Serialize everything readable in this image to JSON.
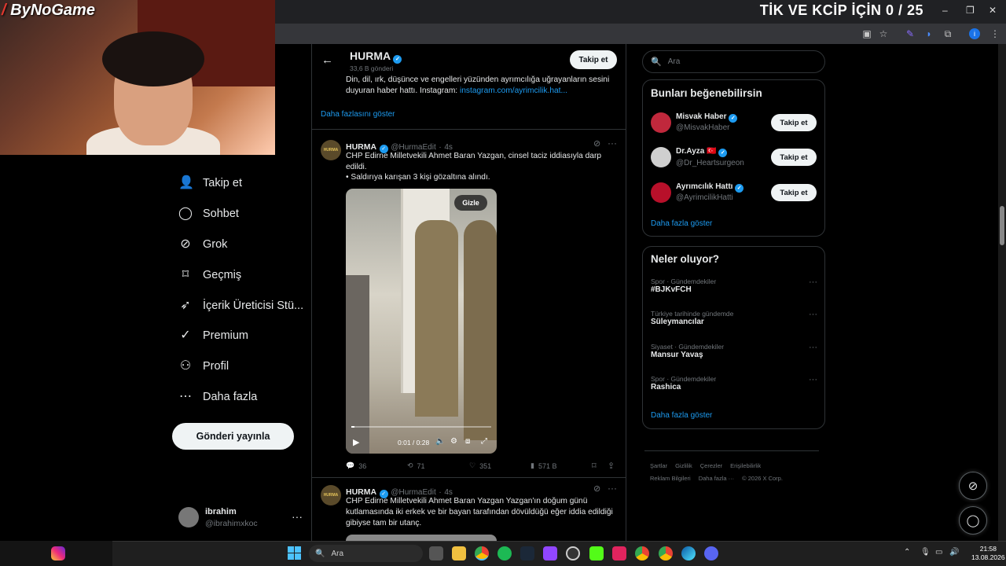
{
  "browser": {
    "tab_title": "TİK VE KCİP İÇİN 0 / 25",
    "win_minimize": "–",
    "win_restore": "❐",
    "win_close": "✕"
  },
  "overlay": {
    "logo_text": "ByNoGame",
    "logo_mark": "/"
  },
  "nav": {
    "items": [
      {
        "label": "Takip et",
        "icon": "person-add-icon"
      },
      {
        "label": "Sohbet",
        "icon": "chat-icon"
      },
      {
        "label": "Grok",
        "icon": "grok-icon"
      },
      {
        "label": "Geçmiş",
        "icon": "bookmark-icon"
      },
      {
        "label": "İçerik Üreticisi Stü...",
        "icon": "rocket-icon"
      },
      {
        "label": "Premium",
        "icon": "verified-icon"
      },
      {
        "label": "Profil",
        "icon": "person-icon"
      },
      {
        "label": "Daha fazla",
        "icon": "more-circle-icon"
      }
    ],
    "post_button": "Gönderi yayınla",
    "account": {
      "name": "ibrahim",
      "handle": "@ibrahimxkoc",
      "more": "···"
    }
  },
  "profile_header": {
    "name": "HURMA",
    "posts_count": "33,6 B gönderi",
    "follow_label": "Takip et",
    "bio": "Din, dil, ırk, düşünce ve engelleri yüzünden ayrımcılığa uğrayanların sesini duyuran haber hattı. Instagram:",
    "bio_link": "instagram.com/ayrimcilik.hat...",
    "show_more": "Daha fazlasını göster"
  },
  "tweets": [
    {
      "name": "HURMA",
      "handle": "@HurmaEdit",
      "time": "4s",
      "avatar_text": "HURMA",
      "text": "CHP Edirne Milletvekili Ahmet Baran Yazgan, cinsel taciz iddiasıyla darp edildi.",
      "text2": "• Saldırıya karışan 3 kişi gözaltına alındı.",
      "video": {
        "hide_label": "Gizle",
        "time": "0:01 / 0:28",
        "progress": 0.02
      },
      "stats": {
        "replies": "36",
        "reposts": "71",
        "likes": "351",
        "views": "571 B"
      }
    },
    {
      "name": "HURMA",
      "handle": "@HurmaEdit",
      "time": "4s",
      "avatar_text": "HURMA",
      "text": "CHP Edirne Milletvekili Ahmet Baran Yazgan Yazgan'ın doğum günü kutlamasında iki erkek ve bir bayan tarafından dövüldüğü eğer iddia edildiği gibiyse tam bir utanç."
    }
  ],
  "search": {
    "placeholder": "Ara"
  },
  "who_to_follow": {
    "title": "Bunları beğenebilirsin",
    "items": [
      {
        "name": "Misvak Haber",
        "handle": "@MisvakHaber",
        "button": "Takip et",
        "color": "#c0283c"
      },
      {
        "name": "Dr.Ayza 🇹🇷",
        "handle": "@Dr_Heartsurgeon",
        "button": "Takip et",
        "color": "#cfcfcf"
      },
      {
        "name": "Ayrımcılık Hattı",
        "handle": "@AyrimcilikHatti",
        "button": "Takip et",
        "color": "#b8102a"
      }
    ],
    "show_more": "Daha fazla göster"
  },
  "trends": {
    "title": "Neler oluyor?",
    "items": [
      {
        "category": "Spor · Gündemdekiler",
        "name": "#BJKvFCH"
      },
      {
        "category": "Türkiye tarihinde gündemde",
        "name": "Süleymancılar"
      },
      {
        "category": "Siyaset · Gündemdekiler",
        "name": "Mansur Yavaş"
      },
      {
        "category": "Spor · Gündemdekiler",
        "name": "Rashica"
      }
    ],
    "show_more": "Daha fazla göster"
  },
  "footer": {
    "links": [
      "Şartlar",
      "Gizlilik",
      "Çerezler",
      "Erişilebilirlik",
      "Reklam Bilgileri",
      "Daha fazla ···",
      "© 2026 X Corp."
    ]
  },
  "taskbar": {
    "search_label": "Ara",
    "time": "21:58",
    "date": "13.08.2026"
  },
  "colors": {
    "accent": "#1d9bf0",
    "background": "#000000",
    "border": "#2f3336",
    "muted": "#71767b"
  }
}
